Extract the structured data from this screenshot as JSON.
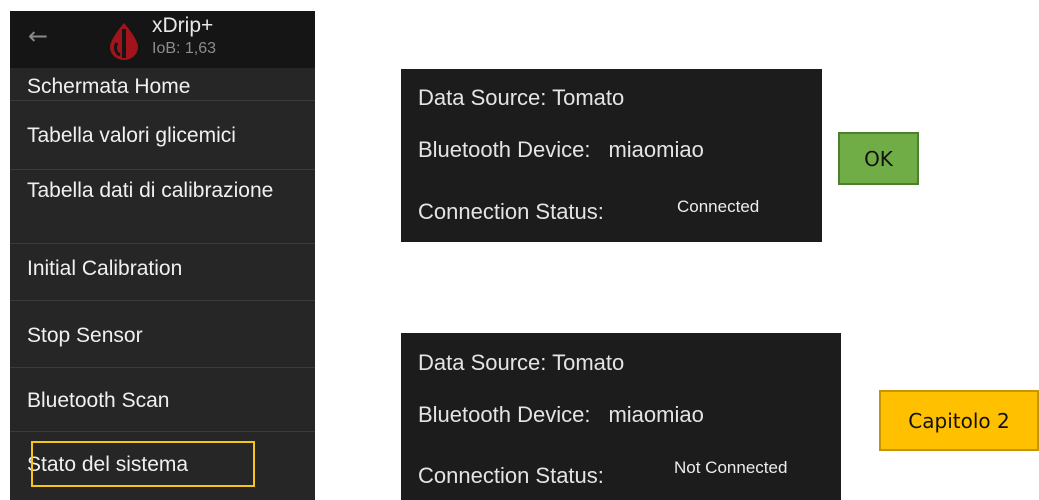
{
  "app": {
    "title": "xDrip+",
    "subtitle": "IoB: 1,63"
  },
  "menu": {
    "partial_item": "Schermata Home",
    "items": [
      "Tabella valori glicemici",
      "Tabella dati di calibrazione",
      "Initial Calibration",
      "Stop Sensor",
      "Bluetooth Scan",
      "Stato del sistema"
    ],
    "highlighted_item": "Stato del sistema",
    "highlight_color": "#f5c518"
  },
  "panels": [
    {
      "data_source": "Data Source: Tomato",
      "bt_label": "Bluetooth Device:",
      "bt_value": "miaomiao",
      "conn_label": "Connection Status:",
      "conn_value": "Connected"
    },
    {
      "data_source": "Data Source: Tomato",
      "bt_label": "Bluetooth Device:",
      "bt_value": "miaomiao",
      "conn_label": "Connection Status:",
      "conn_value": "Not Connected"
    }
  ],
  "callouts": {
    "ok": {
      "label": "OK",
      "color": "#70ad47"
    },
    "chapter": {
      "label": "Capitolo 2",
      "color": "#ffc000"
    }
  },
  "icons": {
    "back": "arrow-left-icon",
    "logo": "blood-drop-icon"
  }
}
